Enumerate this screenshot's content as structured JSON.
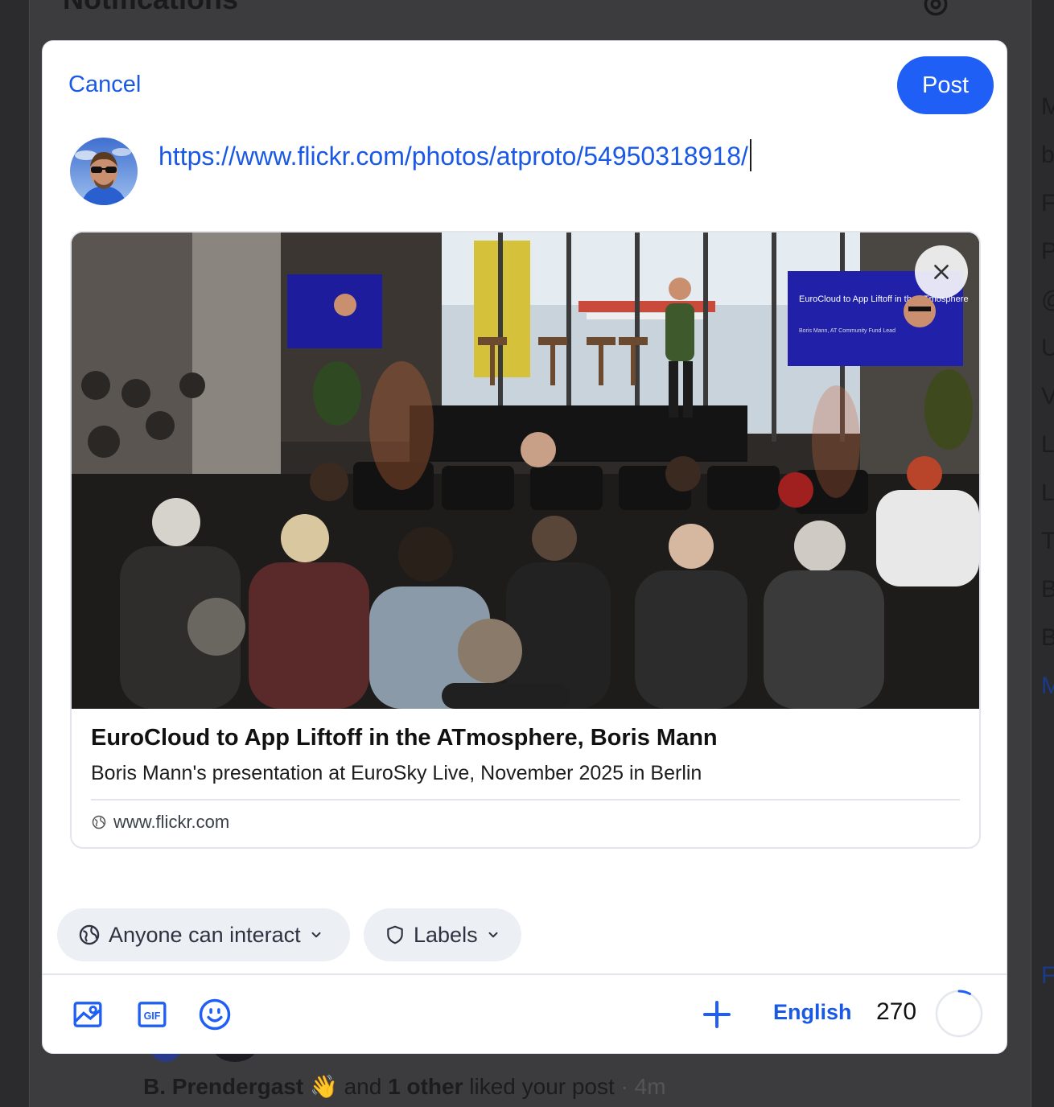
{
  "background": {
    "page_title": "Notifications",
    "sidebar_letters": [
      "M",
      "b",
      "F",
      "P",
      "@",
      "U",
      "V",
      "L",
      "L",
      "T",
      "B",
      "B",
      "M",
      "F"
    ],
    "notification": {
      "actor": "B. Prendergast",
      "emoji": "👋",
      "joiner": "and",
      "others": "1 other",
      "action": "liked your post",
      "time": "· 4m"
    }
  },
  "composer": {
    "cancel_label": "Cancel",
    "post_label": "Post",
    "text": "https://www.flickr.com/photos/atproto/54950318918/"
  },
  "embed": {
    "title": "EuroCloud to App Liftoff in the ATmosphere, Boris Mann",
    "description": "Boris Mann's presentation at EuroSky Live, November 2025 in Berlin",
    "domain": "www.flickr.com",
    "slide_title": "EuroCloud to App Liftoff in the ATmosphere",
    "slide_subtitle": "Boris Mann, AT Community Fund Lead"
  },
  "controls": {
    "interaction_label": "Anyone can interact",
    "labels_label": "Labels",
    "language": "English",
    "char_count": "270",
    "char_progress": 0.08
  },
  "icons": {
    "remove": "close-icon",
    "image": "image-icon",
    "gif": "gif-icon",
    "emoji": "emoji-icon",
    "thread": "plus-icon",
    "globe": "globe-icon",
    "shield": "shield-icon",
    "chevron": "chevron-down-icon"
  },
  "colors": {
    "accent": "#1f5ff5",
    "link": "#1a58e6"
  }
}
